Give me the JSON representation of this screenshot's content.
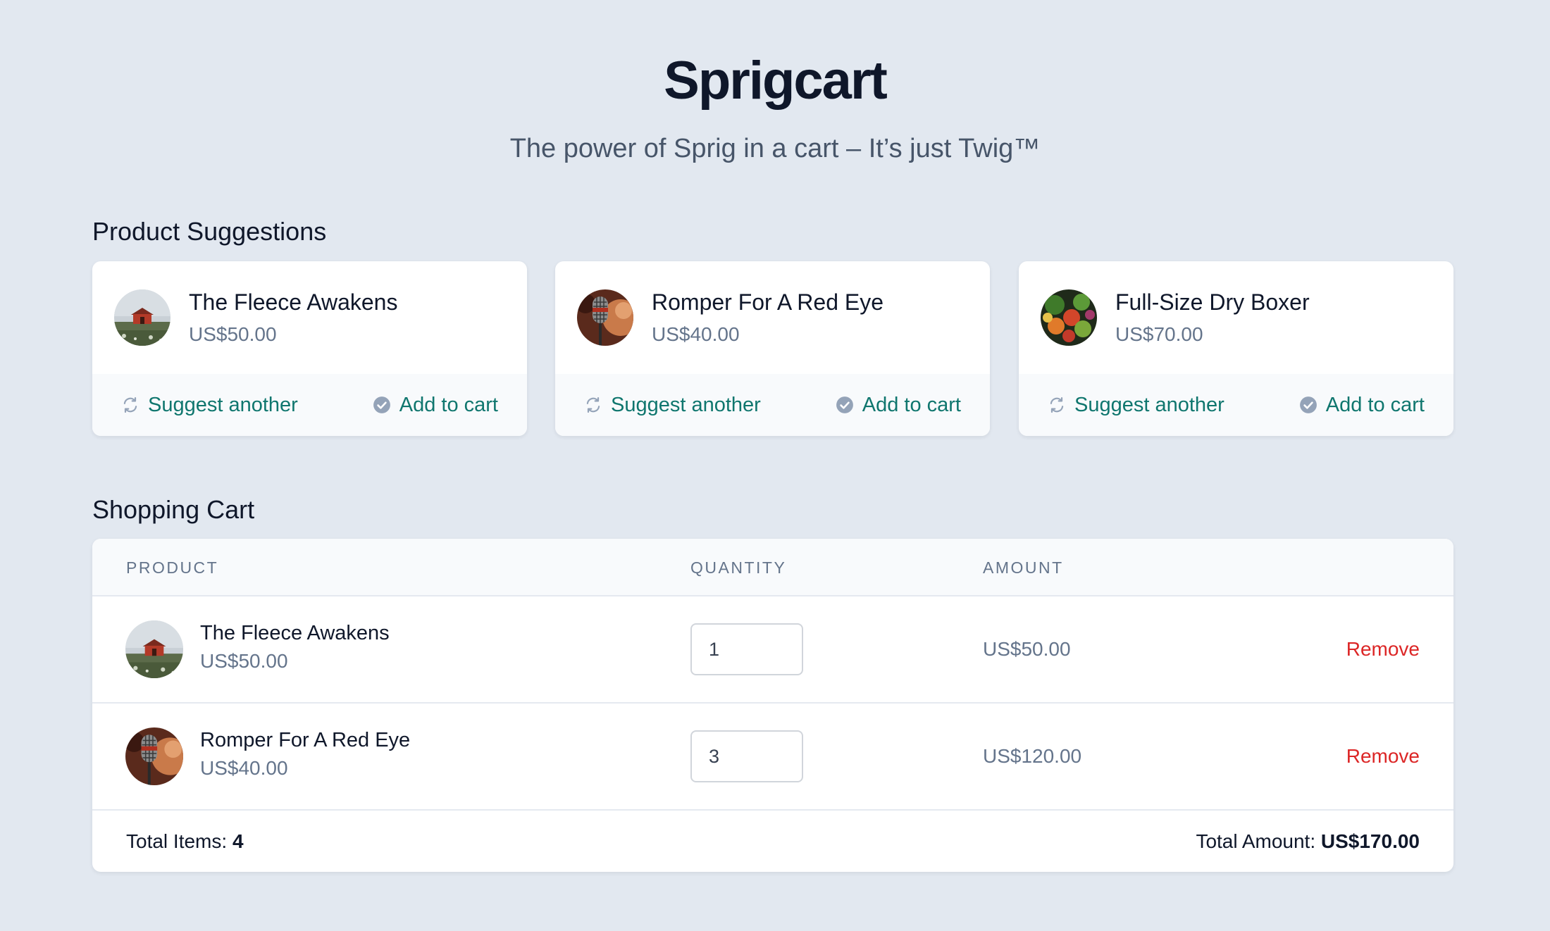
{
  "header": {
    "title": "Sprigcart",
    "subtitle": "The power of Sprig in a cart – It’s just Twig™"
  },
  "suggestions": {
    "heading": "Product Suggestions",
    "items": [
      {
        "name": "The Fleece Awakens",
        "price": "US$50.00",
        "image": "cabin-landscape",
        "suggest_label": "Suggest another",
        "add_label": "Add to cart",
        "suggest_icon": "refresh-icon",
        "add_icon": "check-circle-icon"
      },
      {
        "name": "Romper For A Red Eye",
        "price": "US$40.00",
        "image": "vintage-microphone",
        "suggest_label": "Suggest another",
        "add_label": "Add to cart",
        "suggest_icon": "refresh-icon",
        "add_icon": "check-circle-icon"
      },
      {
        "name": "Full-Size Dry Boxer",
        "price": "US$70.00",
        "image": "vegetables",
        "suggest_label": "Suggest another",
        "add_label": "Add to cart",
        "suggest_icon": "refresh-icon",
        "add_icon": "check-circle-icon"
      }
    ]
  },
  "cart": {
    "heading": "Shopping Cart",
    "columns": [
      "PRODUCT",
      "QUANTITY",
      "AMOUNT"
    ],
    "rows": [
      {
        "name": "The Fleece Awakens",
        "price": "US$50.00",
        "image": "cabin-landscape",
        "quantity": "1",
        "amount": "US$50.00",
        "remove_label": "Remove"
      },
      {
        "name": "Romper For A Red Eye",
        "price": "US$40.00",
        "image": "vintage-microphone",
        "quantity": "3",
        "amount": "US$120.00",
        "remove_label": "Remove"
      }
    ],
    "total_items_label": "Total Items:",
    "total_items": "4",
    "total_amount_label": "Total Amount:",
    "total_amount": "US$170.00"
  },
  "colors": {
    "background": "#e2e8f0",
    "accent": "#0f766e",
    "danger": "#dc2626",
    "text": "#0f172a",
    "muted": "#64748b"
  }
}
